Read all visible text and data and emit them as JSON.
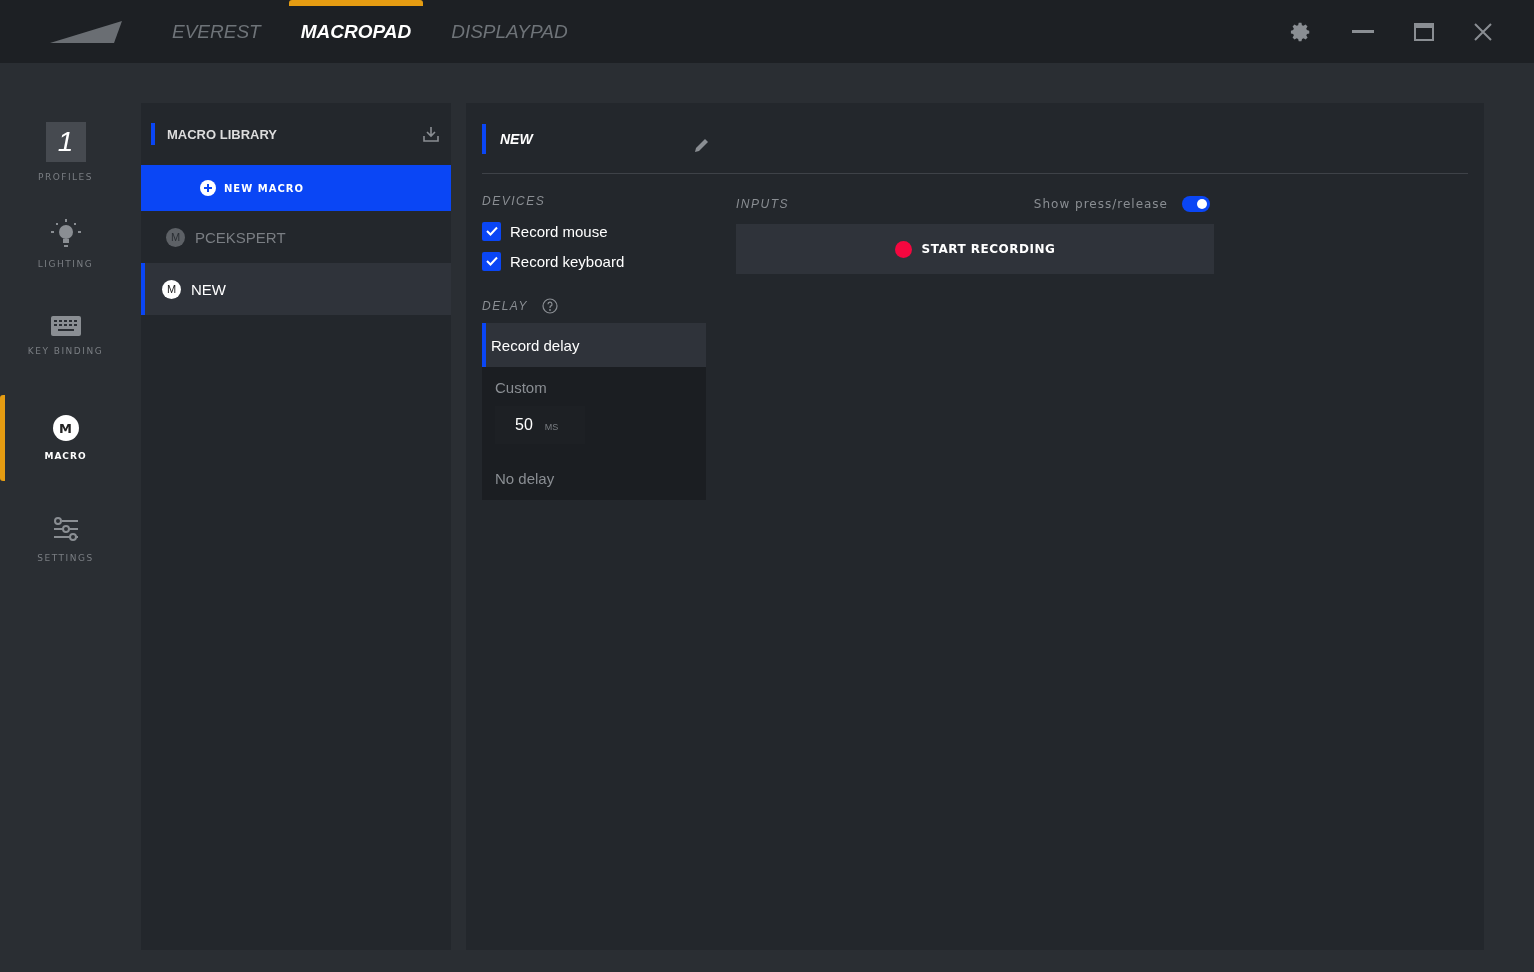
{
  "top_tabs": [
    {
      "label": "EVEREST",
      "selected": false
    },
    {
      "label": "MACROPAD",
      "selected": true
    },
    {
      "label": "DISPLAYPAD",
      "selected": false
    }
  ],
  "nav": [
    {
      "kind": "profile",
      "badge": "1",
      "label": "PROFILES",
      "selected": false
    },
    {
      "kind": "lighting",
      "label": "LIGHTING",
      "selected": false
    },
    {
      "kind": "keyboard",
      "label": "KEY BINDING",
      "selected": false
    },
    {
      "kind": "macro",
      "badge": "M",
      "label": "MACRO",
      "selected": true
    },
    {
      "kind": "settings",
      "label": "SETTINGS",
      "selected": false
    }
  ],
  "library": {
    "title": "MACRO LIBRARY",
    "new_button": "NEW MACRO",
    "items": [
      {
        "badge": "M",
        "name": "PCEKSPERT",
        "selected": false
      },
      {
        "badge": "M",
        "name": "NEW",
        "selected": true
      }
    ]
  },
  "editor": {
    "name": "NEW",
    "devices": {
      "title": "DEVICES",
      "options": [
        {
          "label": "Record mouse",
          "checked": true
        },
        {
          "label": "Record keyboard",
          "checked": true
        }
      ]
    },
    "delay": {
      "title": "DELAY",
      "options": [
        {
          "kind": "plain",
          "label": "Record delay",
          "selected": true
        },
        {
          "kind": "custom",
          "label": "Custom",
          "value": "50",
          "unit": "MS",
          "selected": false
        },
        {
          "kind": "plain",
          "label": "No delay",
          "selected": false
        }
      ]
    },
    "inputs": {
      "title": "INPUTS",
      "toggle_label": "Show press/release",
      "toggle_on": true,
      "record_button": "START RECORDING"
    }
  }
}
